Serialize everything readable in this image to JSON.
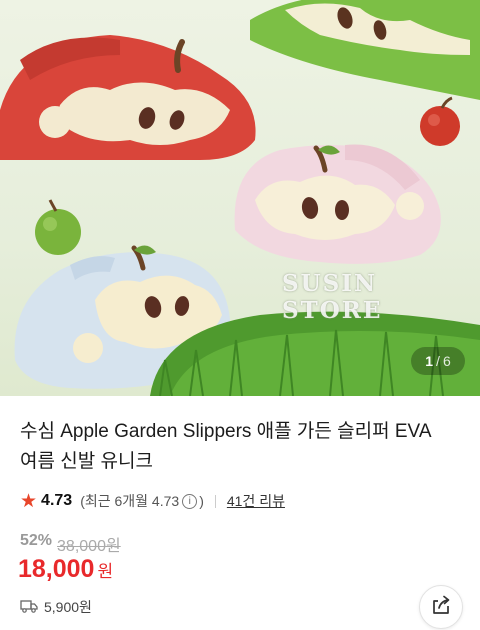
{
  "gallery": {
    "watermark": "SUSIN STORE",
    "current": "1",
    "separator": "/",
    "total": "6"
  },
  "product": {
    "title": "수심 Apple Garden Slippers 애플 가든 슬리퍼 EVA 여름 신발 유니크"
  },
  "rating": {
    "icon": "star-icon",
    "value": "4.73",
    "recent_prefix": "(최근 6개월 4.73",
    "recent_suffix": ")",
    "reviews": "41건 리뷰"
  },
  "pricing": {
    "discount": "52%",
    "original": "38,000원",
    "price": "18,000",
    "currency": "원"
  },
  "shipping": {
    "icon": "delivery-truck-icon",
    "fee": "5,900원"
  },
  "actions": {
    "share_icon": "share-icon"
  },
  "colors": {
    "price": "#e8292b",
    "star": "#e8462b"
  }
}
